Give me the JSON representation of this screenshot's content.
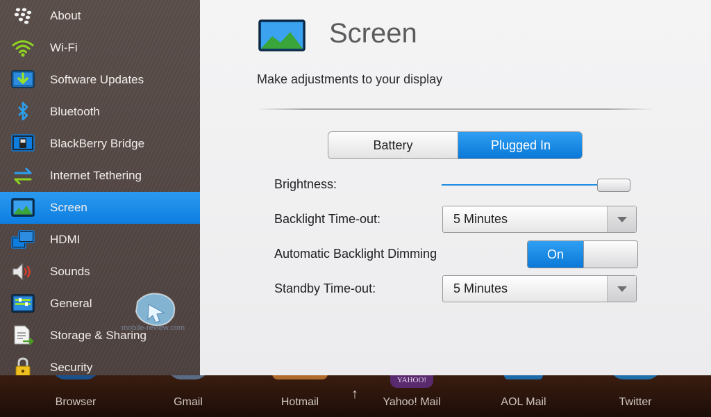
{
  "sidebar": {
    "items": [
      {
        "label": "About",
        "icon": "blackberry-logo-icon"
      },
      {
        "label": "Wi-Fi",
        "icon": "wifi-icon"
      },
      {
        "label": "Software Updates",
        "icon": "download-icon"
      },
      {
        "label": "Bluetooth",
        "icon": "bluetooth-icon"
      },
      {
        "label": "BlackBerry Bridge",
        "icon": "bridge-icon"
      },
      {
        "label": "Internet Tethering",
        "icon": "tethering-icon"
      },
      {
        "label": "Screen",
        "icon": "screen-icon",
        "selected": true
      },
      {
        "label": "HDMI",
        "icon": "hdmi-icon"
      },
      {
        "label": "Sounds",
        "icon": "speaker-icon"
      },
      {
        "label": "General",
        "icon": "general-icon"
      },
      {
        "label": "Storage & Sharing",
        "icon": "storage-icon"
      },
      {
        "label": "Security",
        "icon": "lock-icon"
      }
    ]
  },
  "main": {
    "title": "Screen",
    "subtitle": "Make adjustments to your display",
    "power_tabs": {
      "battery": "Battery",
      "plugged_in": "Plugged In",
      "selected": "plugged_in"
    },
    "brightness": {
      "label": "Brightness:",
      "level": 0.95
    },
    "backlight_timeout": {
      "label": "Backlight Time-out:",
      "value": "5 Minutes"
    },
    "auto_dimming": {
      "label": "Automatic Backlight Dimming",
      "value": "On"
    },
    "standby_timeout": {
      "label": "Standby Time-out:",
      "value": "5 Minutes"
    }
  },
  "dock": {
    "apps": [
      {
        "label": "Browser"
      },
      {
        "label": "Gmail"
      },
      {
        "label": "Hotmail"
      },
      {
        "label": "Yahoo! Mail",
        "logo": "YAHOO!"
      },
      {
        "label": "AOL Mail"
      },
      {
        "label": "Twitter"
      }
    ]
  },
  "colors": {
    "accent": "#0d7ee0",
    "sidebar_bg": "#544845",
    "panel_bg": "#f0f0f1"
  }
}
